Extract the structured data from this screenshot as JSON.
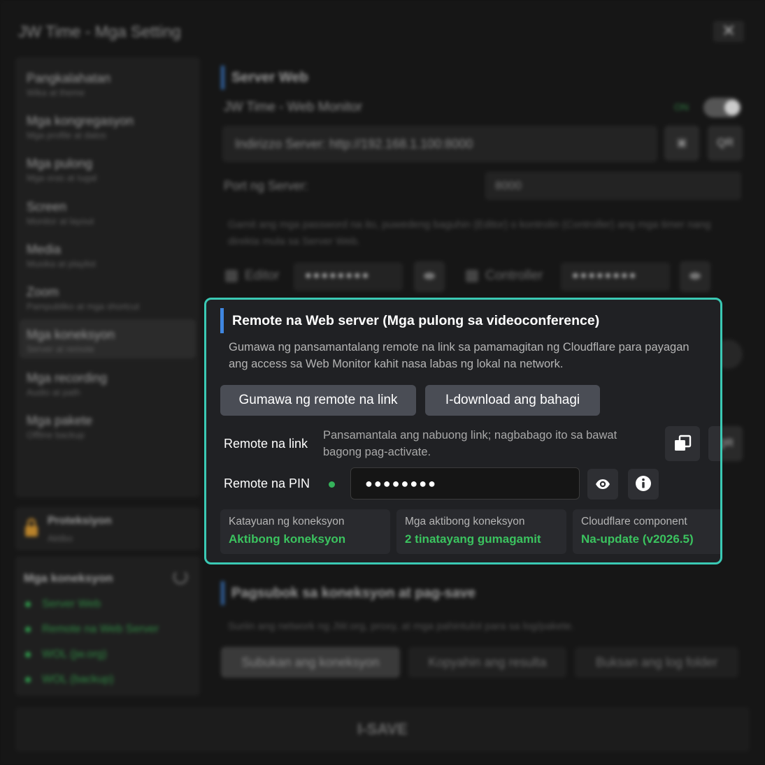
{
  "window": {
    "title": "JW Time - Mga Setting",
    "close_glyph": "✕"
  },
  "sidebar": {
    "items": [
      {
        "label": "Pangkalahatan",
        "sub": "Wika at theme"
      },
      {
        "label": "Mga kongregasyon",
        "sub": "Mga profile at datos"
      },
      {
        "label": "Mga pulong",
        "sub": "Mga oras at Iugal"
      },
      {
        "label": "Screen",
        "sub": "Monitor at layout"
      },
      {
        "label": "Media",
        "sub": "Musika at playlist"
      },
      {
        "label": "Zoom",
        "sub": "Pampubliko at mga shortcut"
      },
      {
        "label": "Mga koneksyon",
        "sub": "Server at remote"
      },
      {
        "label": "Mga recording",
        "sub": "Audio at path"
      },
      {
        "label": "Mga pakete",
        "sub": "Offline backup"
      }
    ],
    "active_index": 6
  },
  "protection": {
    "title": "Proteksiyon",
    "status": "Aktibo"
  },
  "connections": {
    "title": "Mga koneksyon",
    "items": [
      "Server Web",
      "Remote na Web Server",
      "WOL (jw.org)",
      "WOL (backup)"
    ]
  },
  "server_web": {
    "title": "Server Web",
    "monitor_label": "JW Time - Web Monitor",
    "toggle_state": "ON",
    "address": "Indirizzo Server: http://192.168.1.100:8000",
    "qr_label": "QR",
    "port_label": "Port ng Server:",
    "port_value": "8000",
    "note": "Gamit ang mga password na ito, puwedeng baguhin (Editor) o kontrolin (Controller) ang mga timer nang direkta mula sa Server Web.",
    "editor_label": "Editor",
    "editor_mask": "●●●●●●●●",
    "controller_label": "Controller",
    "controller_mask": "●●●●●●●●"
  },
  "remote": {
    "title": "Remote na Web server (Mga pulong sa videoconference)",
    "description": "Gumawa ng pansamantalang remote na link sa pamamagitan ng Cloudflare para payagan ang access sa Web Monitor kahit nasa labas ng lokal na network.",
    "create_button": "Gumawa ng remote na link",
    "download_button": "I-download ang bahagi",
    "link_label": "Remote na link",
    "link_hint": "Pansamantala ang nabuong link; nagbabago ito sa bawat bagong pag-activate.",
    "qr_label": "QR",
    "pin_label": "Remote na PIN",
    "pin_mask": "●●●●●●●●",
    "status_color": "#35b35b",
    "cards": [
      {
        "title": "Katayuan ng koneksyon",
        "value": "Aktibong koneksyon"
      },
      {
        "title": "Mga aktibong koneksyon",
        "value": "2 tinatayang gumagamit"
      },
      {
        "title": "Cloudflare component",
        "value": "Na-update (v2026.5)"
      }
    ]
  },
  "test_section": {
    "title": "Pagsubok sa koneksyon at pag-save",
    "note": "Suriin ang network ng JW.org, proxy, at mga pahintulot para sa log/pakete.",
    "buttons": [
      "Subukan ang koneksyon",
      "Kopyahin ang resulta",
      "Buksan ang log folder"
    ]
  },
  "save_button": "I-SAVE",
  "colors": {
    "accent_teal": "#3ac9b4",
    "accent_blue": "#3f86e0",
    "success_green": "#3bc35f"
  }
}
